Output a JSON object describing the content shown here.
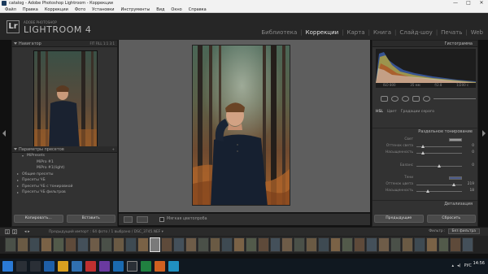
{
  "window": {
    "title": "catalog - Adobe Photoshop Lightroom - Коррекции",
    "min_glyph": "—",
    "max_glyph": "□",
    "close_glyph": "✕"
  },
  "menu": [
    "Файл",
    "Правка",
    "Коррекции",
    "Фото",
    "Установки",
    "Инструменты",
    "Вид",
    "Окно",
    "Справка"
  ],
  "lr": {
    "logo": "Lr",
    "brand_sub": "ADOBE PHOTOSHOP",
    "brand": "LIGHTROOM 4",
    "modules": [
      "Библиотека",
      "Коррекции",
      "Карта",
      "Книга",
      "Слайд-шоу",
      "Печать",
      "Web"
    ],
    "active_module": "Коррекции"
  },
  "left": {
    "navigator": {
      "title": "Навигатор",
      "zoom": "FIT  FILL  1:1  3:1"
    },
    "presets_title": "Параметры пресетов",
    "presets": [
      {
        "label": "MiPresets",
        "level": "sub",
        "open": true
      },
      {
        "label": "MiPro #1",
        "level": "sub2"
      },
      {
        "label": "MiPro #1(light)",
        "level": "sub2"
      },
      {
        "label": "Общие пресеты",
        "level": "sub"
      },
      {
        "label": "Пресеты ЧБ",
        "level": "sub"
      },
      {
        "label": "Пресеты ЧБ с тонировкой",
        "level": "sub"
      },
      {
        "label": "Пресеты ЧБ фильтров",
        "level": "sub"
      }
    ],
    "copy_label": "Копировать...",
    "paste_label": "Вставить"
  },
  "toolbar": {
    "soft_proof_label": "Мягкая цветопроба"
  },
  "right": {
    "histogram_title": "Гистограмма",
    "histogram_labels": [
      "ISO 800",
      "35 мм",
      "f/2.8",
      "1/200 с"
    ],
    "hsl_tabs": [
      "HSL",
      "Цвет",
      "Градации серого"
    ],
    "split_toning_title": "Раздельное тонирование",
    "highlights_label": "Свет",
    "shadows_label": "Тени",
    "rows_top": [
      {
        "name": "Оттенок света",
        "val": "0"
      },
      {
        "name": "Насыщенность",
        "val": "0"
      }
    ],
    "balance": {
      "name": "Баланс",
      "val": "0"
    },
    "rows_bottom": [
      {
        "name": "Оттенок цвета",
        "val": "219"
      },
      {
        "name": "Насыщенность",
        "val": "18"
      }
    ],
    "details_title": "Детализация",
    "prev_label": "Предыдущие",
    "reset_label": "Сбросить"
  },
  "strip": {
    "nums": [
      "1",
      "2"
    ],
    "nav": "◂ ▸",
    "info": "Предыдущий импорт : 64 фото / 1 выбрано / DSC_3745.NEF ▾",
    "filter_label": "Фильтр :",
    "filter_value": "Без фильтра"
  },
  "taskbar": {
    "lang": "РУС",
    "time": "14:56"
  },
  "colors": {
    "accent": "#e6e6e6",
    "panel": "#323232",
    "canvas": "#5e5e5e"
  }
}
